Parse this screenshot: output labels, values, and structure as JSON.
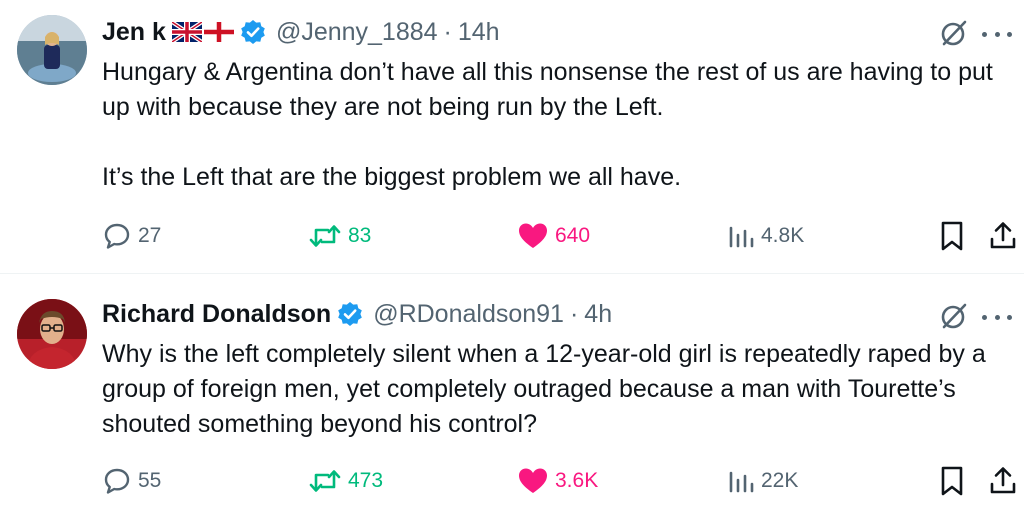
{
  "tweets": [
    {
      "author_name": "Jen k",
      "handle": "@Jenny_1884",
      "separator": "·",
      "time": "14h",
      "flags": [
        "uk-flag-icon",
        "england-flag-icon"
      ],
      "text": [
        "Hungary & Argentina don’t have all this nonsense the rest of us are having to put up with because they are not being run by the Left.",
        "It’s the Left that are the biggest problem we all have."
      ],
      "replies": "27",
      "reposts": "83",
      "likes": "640",
      "views": "4.8K"
    },
    {
      "author_name": "Richard Donaldson",
      "handle": "@RDonaldson91",
      "separator": "·",
      "time": "4h",
      "text": [
        "Why is the left completely silent when a 12-year-old girl is repeatedly raped by a group of foreign men, yet completely outraged because a man with Tourette’s shouted something beyond his control?"
      ],
      "replies": "55",
      "reposts": "473",
      "likes": "3.6K",
      "views": "22K"
    }
  ],
  "colors": {
    "text": "#0f1419",
    "secondary": "#536471",
    "verified": "#1d9bf0",
    "repost": "#00ba7c",
    "like": "#f91880"
  }
}
